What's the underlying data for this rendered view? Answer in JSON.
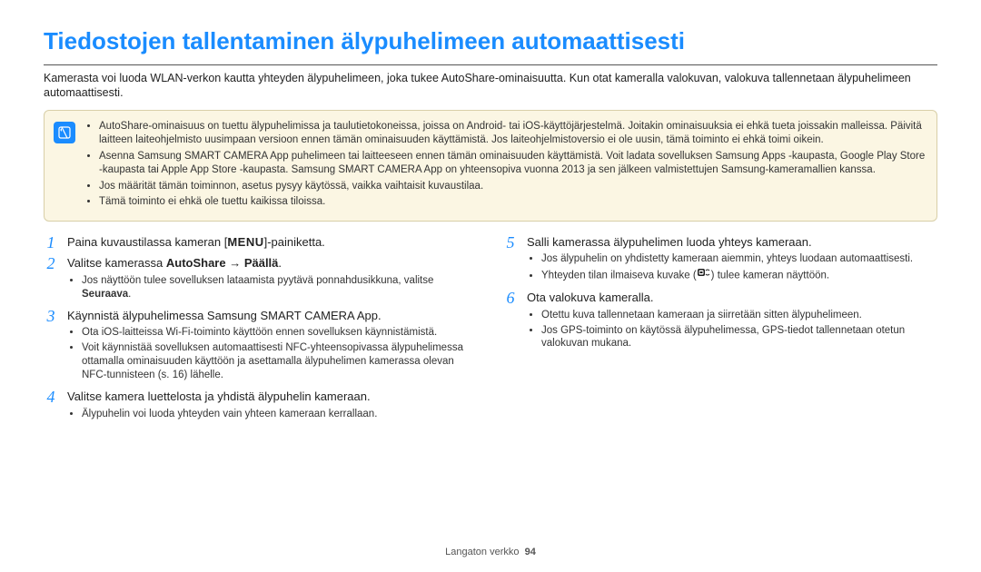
{
  "title": "Tiedostojen tallentaminen älypuhelimeen automaattisesti",
  "intro": "Kamerasta voi luoda WLAN-verkon kautta yhteyden älypuhelimeen, joka tukee AutoShare-ominaisuutta. Kun otat kameralla valokuvan, valokuva tallennetaan älypuhelimeen automaattisesti.",
  "note": {
    "items": [
      "AutoShare-ominaisuus on tuettu älypuhelimissa ja taulutietokoneissa, joissa on Android- tai iOS-käyttöjärjestelmä. Joitakin ominaisuuksia ei ehkä tueta joissakin malleissa. Päivitä laitteen laiteohjelmisto uusimpaan versioon ennen tämän ominaisuuden käyttämistä. Jos laiteohjelmistoversio ei ole uusin, tämä toiminto ei ehkä toimi oikein.",
      "Asenna Samsung SMART CAMERA App puhelimeen tai laitteeseen ennen tämän ominaisuuden käyttämistä. Voit ladata sovelluksen Samsung Apps -kaupasta, Google Play Store -kaupasta tai Apple App Store -kaupasta. Samsung SMART CAMERA App on yhteensopiva vuonna 2013 ja sen jälkeen valmistettujen Samsung-kameramallien kanssa.",
      "Jos määrität tämän toiminnon, asetus pysyy käytössä, vaikka vaihtaisit kuvaustilaa.",
      "Tämä toiminto ei ehkä ole tuettu kaikissa tiloissa."
    ]
  },
  "left": {
    "step1": {
      "num": "1",
      "pre": "Paina kuvaustilassa kameran [",
      "menu": "MENU",
      "post": "]-painiketta."
    },
    "step2": {
      "num": "2",
      "pre": "Valitse kamerassa ",
      "bold": "AutoShare → Päällä",
      "post": ".",
      "bullets": [
        {
          "text": "Jos näyttöön tulee sovelluksen lataamista pyytävä ponnahdusikkuna, valitse ",
          "bold": "Seuraava",
          "after": "."
        }
      ]
    },
    "step3": {
      "num": "3",
      "title": "Käynnistä älypuhelimessa Samsung SMART CAMERA App.",
      "bullets": [
        "Ota iOS-laitteissa Wi-Fi-toiminto käyttöön ennen sovelluksen käynnistämistä.",
        "Voit käynnistää sovelluksen automaattisesti NFC-yhteensopivassa älypuhelimessa ottamalla ominaisuuden käyttöön ja asettamalla älypuhelimen kamerassa olevan NFC-tunnisteen (s. 16) lähelle."
      ]
    },
    "step4": {
      "num": "4",
      "title": "Valitse kamera luettelosta ja yhdistä älypuhelin kameraan.",
      "bullets": [
        "Älypuhelin voi luoda yhteyden vain yhteen kameraan kerrallaan."
      ]
    }
  },
  "right": {
    "step5": {
      "num": "5",
      "title": "Salli kamerassa älypuhelimen luoda yhteys kameraan.",
      "bullets": [
        {
          "text": "Jos älypuhelin on yhdistetty kameraan aiemmin, yhteys luodaan automaattisesti."
        },
        {
          "pre": "Yhteyden tilan ilmaiseva kuvake (",
          "icon": true,
          "post": ") tulee kameran näyttöön."
        }
      ]
    },
    "step6": {
      "num": "6",
      "title": "Ota valokuva kameralla.",
      "bullets": [
        "Otettu kuva tallennetaan kameraan ja siirretään sitten älypuhelimeen.",
        "Jos GPS-toiminto on käytössä älypuhelimessa, GPS-tiedot tallennetaan otetun valokuvan mukana."
      ]
    }
  },
  "footer": {
    "section": "Langaton verkko",
    "page": "94"
  },
  "chart_data": {
    "type": "table",
    "note": "This page is a textual document; no chart data present."
  }
}
